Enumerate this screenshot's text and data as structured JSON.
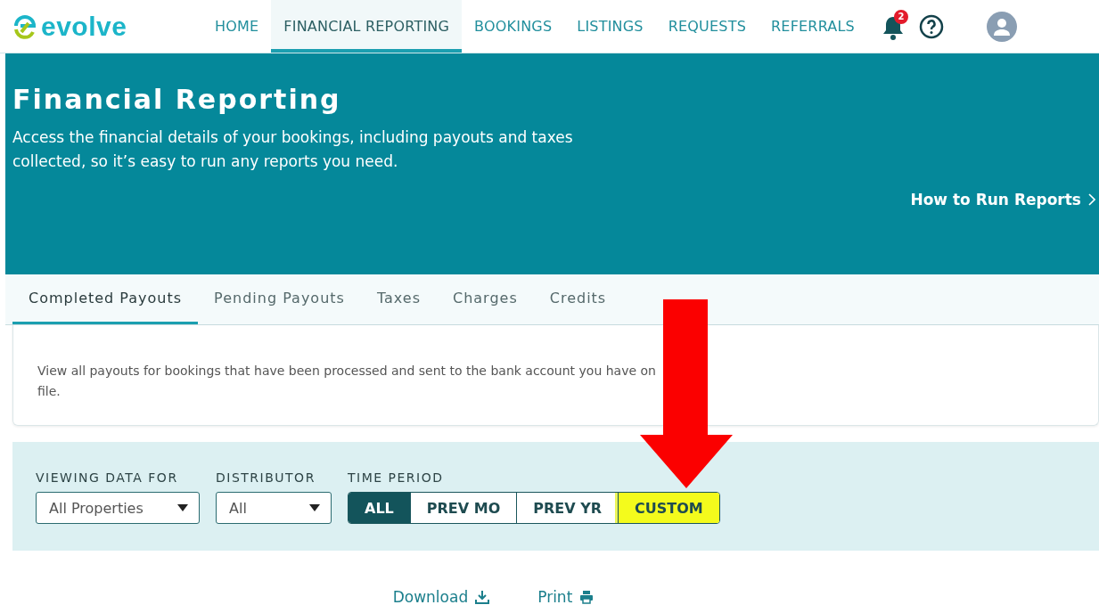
{
  "brand": {
    "name": "evolve"
  },
  "nav": [
    {
      "label": "HOME",
      "selected": false
    },
    {
      "label": "FINANCIAL REPORTING",
      "selected": true
    },
    {
      "label": "BOOKINGS",
      "selected": false
    },
    {
      "label": "LISTINGS",
      "selected": false
    },
    {
      "label": "REQUESTS",
      "selected": false
    },
    {
      "label": "REFERRALS",
      "selected": false
    }
  ],
  "notifications": {
    "count": "2"
  },
  "hero": {
    "title": "Financial Reporting",
    "description": "Access the financial details of your bookings, including payouts and taxes collected, so it’s easy to run any reports you need.",
    "link": "How to Run Reports"
  },
  "tabs": [
    {
      "label": "Completed Payouts",
      "selected": true
    },
    {
      "label": "Pending Payouts",
      "selected": false
    },
    {
      "label": "Taxes",
      "selected": false
    },
    {
      "label": "Charges",
      "selected": false
    },
    {
      "label": "Credits",
      "selected": false
    }
  ],
  "info_text": "View all payouts for bookings that have been processed and sent to the bank account you have on file.",
  "filters": [
    {
      "kind": "select",
      "label": "VIEWING DATA FOR",
      "value": "All Properties"
    },
    {
      "kind": "select",
      "label": "DISTRIBUTOR",
      "value": "All"
    },
    {
      "kind": "segmented",
      "label": "TIME PERIOD",
      "options": [
        {
          "label": "ALL",
          "selected": true,
          "highlighted": false
        },
        {
          "label": "PREV MO",
          "selected": false,
          "highlighted": false
        },
        {
          "label": "PREV YR",
          "selected": false,
          "highlighted": false
        },
        {
          "label": "CUSTOM",
          "selected": false,
          "highlighted": true
        }
      ]
    }
  ],
  "actions": [
    {
      "kind": "download",
      "label": "Download"
    },
    {
      "kind": "print",
      "label": "Print"
    }
  ],
  "annotation": {
    "kind": "arrow"
  }
}
